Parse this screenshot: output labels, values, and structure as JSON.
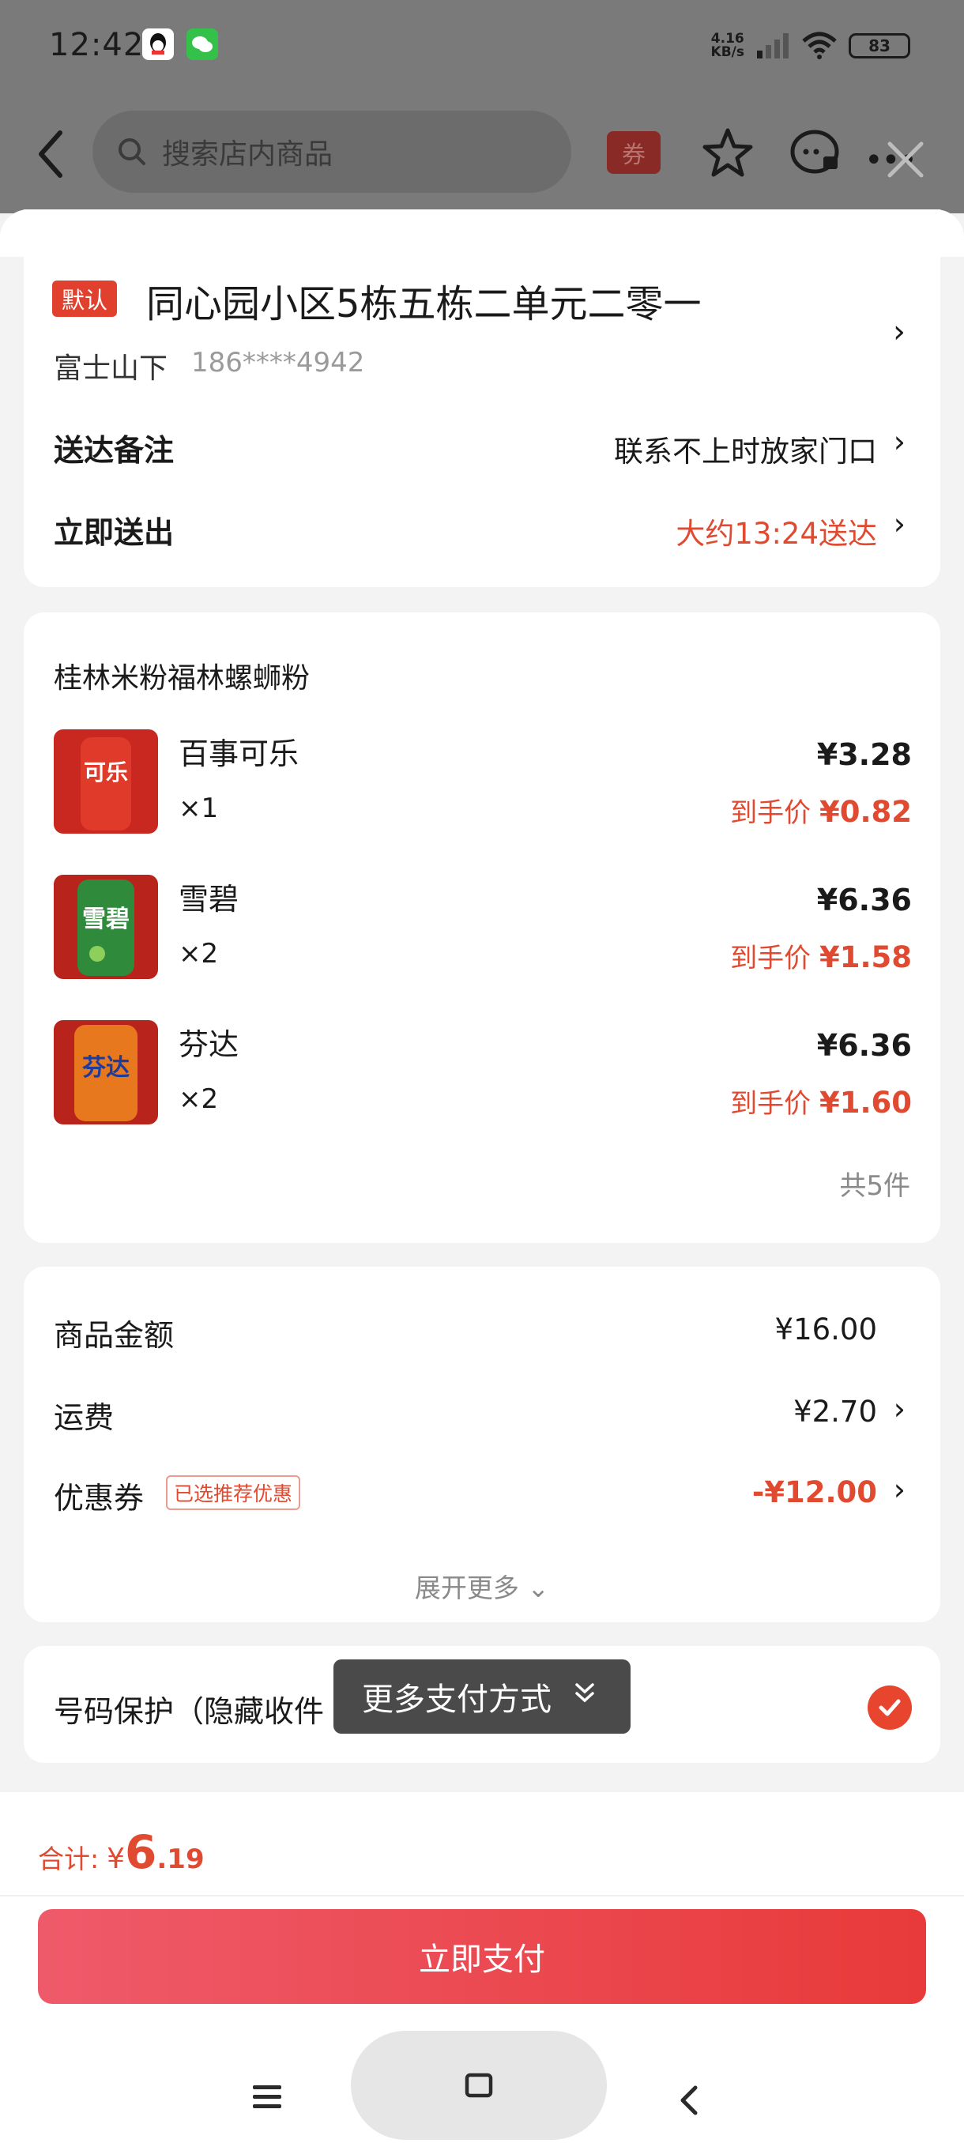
{
  "status_bar": {
    "time": "12:42",
    "net_speed_value": "4.16",
    "net_speed_unit": "KB/s",
    "battery": "83"
  },
  "header": {
    "search_placeholder": "搜索店内商品",
    "coupon_label": "券"
  },
  "address": {
    "default_badge": "默认",
    "title": "同心园小区5栋五栋二单元二零一",
    "name": "富士山下",
    "phone": "186****4942",
    "note_label": "送达备注",
    "note_value": "联系不上时放家门口",
    "delivery_label": "立即送出",
    "delivery_value": "大约13:24送达"
  },
  "order": {
    "shop_name": "桂林米粉福林螺蛳粉",
    "final_price_prefix": "到手价",
    "items": [
      {
        "name": "百事可乐",
        "qty": "×1",
        "price": "¥3.28",
        "final_price": "¥0.82",
        "thumb_color": "#c8281f"
      },
      {
        "name": "雪碧",
        "qty": "×2",
        "price": "¥6.36",
        "final_price": "¥1.58",
        "thumb_color": "#2f8a3c"
      },
      {
        "name": "芬达",
        "qty": "×2",
        "price": "¥6.36",
        "final_price": "¥1.60",
        "thumb_color": "#e8781e"
      }
    ],
    "total_count": "共5件"
  },
  "fees": {
    "goods_label": "商品金额",
    "goods_value": "¥16.00",
    "shipping_label": "运费",
    "shipping_value": "¥2.70",
    "coupon_label": "优惠券",
    "coupon_badge": "已选推荐优惠",
    "coupon_value": "-¥12.00",
    "expand_more": "展开更多"
  },
  "privacy": {
    "label": "号码保护（隐藏收件",
    "more_pay": "更多支付方式"
  },
  "pay_bar": {
    "total_label": "合计:",
    "currency": "¥",
    "total_int": "6",
    "total_dec": ".19",
    "pay_button": "立即支付"
  },
  "colors": {
    "accent_red": "#e04a30",
    "badge_red": "#e2402f",
    "pay_gradient_start": "#ef5a6a",
    "pay_gradient_end": "#e83a3a"
  }
}
